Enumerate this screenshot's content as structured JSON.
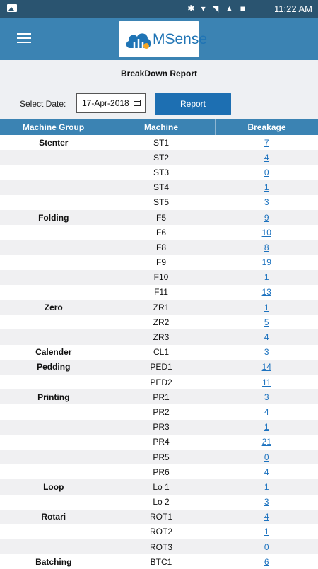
{
  "status_bar": {
    "time": "11:22 AM",
    "icons": [
      "image-icon",
      "bluetooth-icon",
      "vibrate-icon",
      "wifi-icon",
      "signal-icon",
      "no-sim-icon",
      "battery-icon"
    ]
  },
  "app": {
    "logo_text": "MSense"
  },
  "report": {
    "title": "BreakDown Report",
    "date_label": "Select Date:",
    "date_value": "17-Apr-2018",
    "button_label": "Report"
  },
  "table": {
    "headers": [
      "Machine Group",
      "Machine",
      "Breakage"
    ],
    "rows": [
      [
        "Stenter",
        "ST1",
        "7"
      ],
      [
        "",
        "ST2",
        "4"
      ],
      [
        "",
        "ST3",
        "0"
      ],
      [
        "",
        "ST4",
        "1"
      ],
      [
        "",
        "ST5",
        "3"
      ],
      [
        "Folding",
        "F5",
        "9"
      ],
      [
        "",
        "F6",
        "10"
      ],
      [
        "",
        "F8",
        "8"
      ],
      [
        "",
        "F9",
        "19"
      ],
      [
        "",
        "F10",
        "1"
      ],
      [
        "",
        "F11",
        "13"
      ],
      [
        "Zero",
        "ZR1",
        "1"
      ],
      [
        "",
        "ZR2",
        "5"
      ],
      [
        "",
        "ZR3",
        "4"
      ],
      [
        "Calender",
        "CL1",
        "3"
      ],
      [
        "Pedding",
        "PED1",
        "14"
      ],
      [
        "",
        "PED2",
        "11"
      ],
      [
        "Printing",
        "PR1",
        "3"
      ],
      [
        "",
        "PR2",
        "4"
      ],
      [
        "",
        "PR3",
        "1"
      ],
      [
        "",
        "PR4",
        "21"
      ],
      [
        "",
        "PR5",
        "0"
      ],
      [
        "",
        "PR6",
        "4"
      ],
      [
        "Loop",
        "Lo 1",
        "1"
      ],
      [
        "",
        "Lo 2",
        "3"
      ],
      [
        "Rotari",
        "ROT1",
        "4"
      ],
      [
        "",
        "ROT2",
        "1"
      ],
      [
        "",
        "ROT3",
        "0"
      ],
      [
        "Batching",
        "BTC1",
        "6"
      ]
    ]
  },
  "colors": {
    "status_bar": "#2a5470",
    "app_bar": "#3b83b3",
    "button": "#1d6fb2",
    "link": "#1c72bf"
  }
}
